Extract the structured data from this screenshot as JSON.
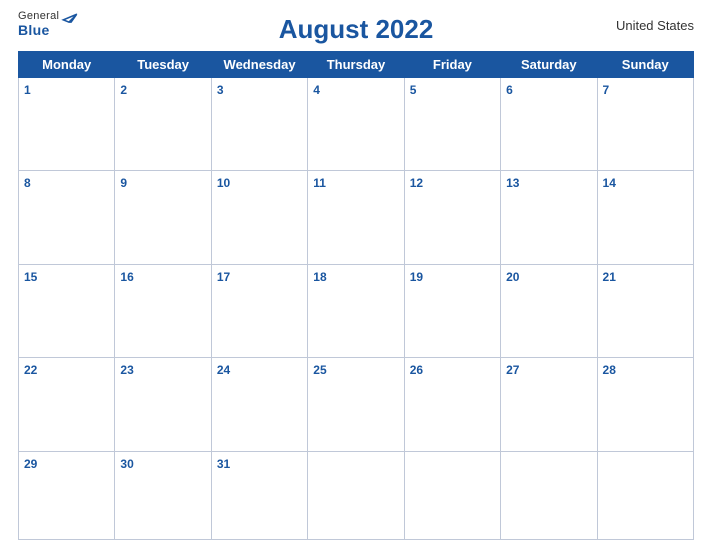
{
  "header": {
    "logo": {
      "general": "General",
      "blue": "Blue",
      "bird_unicode": "🐦"
    },
    "title": "August 2022",
    "country": "United States"
  },
  "days_of_week": [
    "Monday",
    "Tuesday",
    "Wednesday",
    "Thursday",
    "Friday",
    "Saturday",
    "Sunday"
  ],
  "weeks": [
    [
      "1",
      "2",
      "3",
      "4",
      "5",
      "6",
      "7"
    ],
    [
      "8",
      "9",
      "10",
      "11",
      "12",
      "13",
      "14"
    ],
    [
      "15",
      "16",
      "17",
      "18",
      "19",
      "20",
      "21"
    ],
    [
      "22",
      "23",
      "24",
      "25",
      "26",
      "27",
      "28"
    ],
    [
      "29",
      "30",
      "31",
      "",
      "",
      "",
      ""
    ]
  ],
  "colors": {
    "header_bg": "#1a56a0",
    "header_text": "#ffffff",
    "day_number": "#1a56a0",
    "border": "#c0c8d8"
  }
}
